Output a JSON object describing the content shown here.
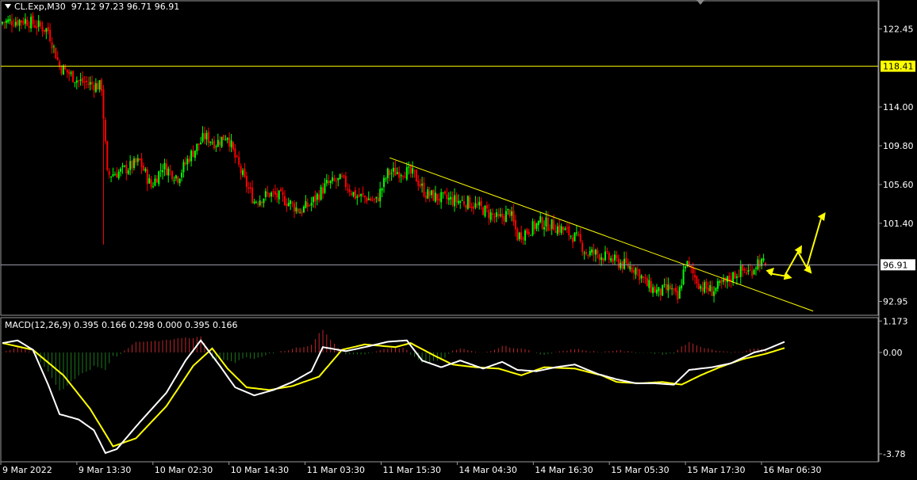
{
  "header": {
    "symbol": "CL.Exp,M30",
    "ohlc": "97.12 97.23 96.71 96.91"
  },
  "macd_header": {
    "label": "MACD(12,26,9)",
    "values": "0.395 0.166 0.298 0.000 0.395 0.166"
  },
  "colors": {
    "background": "#000000",
    "bull": "#00ff00",
    "bear": "#ff0000",
    "level_line": "#ffff00",
    "trendline": "#ffff00",
    "macd_main": "#ffffff",
    "macd_signal": "#ffff00",
    "price_line": "#a0a0b0",
    "arrows": "#ffff00"
  },
  "chart_data": [
    {
      "type": "candlestick",
      "title": "CL.Exp,M30",
      "price_axis_ticks": [
        "122.45",
        "118.41",
        "114.00",
        "109.80",
        "105.60",
        "101.40",
        "96.91",
        "92.95"
      ],
      "ylim": [
        91.4,
        125.5
      ],
      "time_axis_ticks": [
        "9 Mar 2022",
        "9 Mar 13:30",
        "10 Mar 02:30",
        "10 Mar 14:30",
        "11 Mar 03:30",
        "11 Mar 15:30",
        "14 Mar 04:30",
        "14 Mar 16:30",
        "15 Mar 05:30",
        "15 Mar 17:30",
        "16 Mar 06:30"
      ],
      "horizontal_level": "118.41",
      "current_price": "96.91",
      "last_bar": {
        "open": 97.12,
        "high": 97.23,
        "low": 96.71,
        "close": 96.91
      },
      "trendline": {
        "start": {
          "bar": 203,
          "price": 108.5
        },
        "end": {
          "bar": 425,
          "price": 91.9
        }
      },
      "close_path": [
        [
          0,
          123.2
        ],
        [
          12,
          123.4
        ],
        [
          24,
          122.3
        ],
        [
          30,
          118.4
        ],
        [
          40,
          116.8
        ],
        [
          52,
          116.2
        ],
        [
          55,
          106.6
        ],
        [
          62,
          107.0
        ],
        [
          72,
          108.1
        ],
        [
          78,
          105.4
        ],
        [
          84,
          107.6
        ],
        [
          92,
          106.4
        ],
        [
          98,
          108.6
        ],
        [
          106,
          110.8
        ],
        [
          112,
          110.1
        ],
        [
          118,
          111.0
        ],
        [
          122,
          108.5
        ],
        [
          127,
          106.0
        ],
        [
          132,
          103.8
        ],
        [
          140,
          104.6
        ],
        [
          146,
          104.2
        ],
        [
          152,
          103.4
        ],
        [
          156,
          102.7
        ],
        [
          162,
          103.6
        ],
        [
          170,
          105.6
        ],
        [
          178,
          106.1
        ],
        [
          185,
          104.4
        ],
        [
          190,
          104.2
        ],
        [
          196,
          103.8
        ],
        [
          202,
          106.8
        ],
        [
          210,
          107.1
        ],
        [
          216,
          106.6
        ],
        [
          222,
          104.6
        ],
        [
          228,
          104.2
        ],
        [
          236,
          103.9
        ],
        [
          244,
          103.7
        ],
        [
          252,
          102.9
        ],
        [
          260,
          101.8
        ],
        [
          266,
          102.7
        ],
        [
          270,
          100.0
        ],
        [
          276,
          100.7
        ],
        [
          282,
          101.5
        ],
        [
          288,
          101.2
        ],
        [
          294,
          100.7
        ],
        [
          302,
          99.6
        ],
        [
          306,
          98.2
        ],
        [
          312,
          98.1
        ],
        [
          318,
          97.6
        ],
        [
          326,
          96.9
        ],
        [
          332,
          96.5
        ],
        [
          338,
          94.7
        ],
        [
          344,
          93.9
        ],
        [
          350,
          94.4
        ],
        [
          354,
          93.1
        ],
        [
          358,
          97.2
        ],
        [
          362,
          95.9
        ],
        [
          366,
          94.6
        ],
        [
          372,
          94.1
        ],
        [
          378,
          94.8
        ],
        [
          384,
          95.9
        ],
        [
          388,
          96.3
        ],
        [
          392,
          96.1
        ],
        [
          396,
          97.3
        ],
        [
          400,
          96.91
        ]
      ],
      "forecast_arrows": "yellow projection arrows pointing up to the right of the last bar"
    },
    {
      "type": "macd",
      "title": "MACD(12,26,9)",
      "params": [
        12,
        26,
        9
      ],
      "values": {
        "main": 0.395,
        "signal": 0.166
      },
      "axis_ticks": [
        "1.173",
        "0.00",
        "-3.78"
      ],
      "ylim": [
        -3.78,
        1.173
      ],
      "main_path": [
        [
          0,
          0.35
        ],
        [
          8,
          0.45
        ],
        [
          16,
          0.1
        ],
        [
          24,
          -1.2
        ],
        [
          30,
          -2.3
        ],
        [
          40,
          -2.5
        ],
        [
          48,
          -2.9
        ],
        [
          54,
          -3.75
        ],
        [
          60,
          -3.6
        ],
        [
          72,
          -2.6
        ],
        [
          86,
          -1.5
        ],
        [
          96,
          -0.3
        ],
        [
          104,
          0.45
        ],
        [
          114,
          -0.5
        ],
        [
          122,
          -1.3
        ],
        [
          132,
          -1.6
        ],
        [
          142,
          -1.4
        ],
        [
          152,
          -1.1
        ],
        [
          162,
          -0.7
        ],
        [
          168,
          0.2
        ],
        [
          180,
          0.05
        ],
        [
          190,
          0.2
        ],
        [
          202,
          0.4
        ],
        [
          212,
          0.45
        ],
        [
          220,
          -0.3
        ],
        [
          230,
          -0.55
        ],
        [
          240,
          -0.3
        ],
        [
          252,
          -0.6
        ],
        [
          262,
          -0.35
        ],
        [
          270,
          -0.65
        ],
        [
          280,
          -0.7
        ],
        [
          290,
          -0.55
        ],
        [
          300,
          -0.45
        ],
        [
          312,
          -0.8
        ],
        [
          322,
          -1.0
        ],
        [
          332,
          -1.15
        ],
        [
          342,
          -1.15
        ],
        [
          352,
          -1.2
        ],
        [
          360,
          -0.65
        ],
        [
          372,
          -0.55
        ],
        [
          382,
          -0.4
        ],
        [
          394,
          0.0
        ],
        [
          400,
          0.1
        ],
        [
          410,
          0.395
        ]
      ],
      "signal_path": [
        [
          0,
          0.35
        ],
        [
          16,
          0.1
        ],
        [
          32,
          -0.85
        ],
        [
          46,
          -2.1
        ],
        [
          58,
          -3.5
        ],
        [
          70,
          -3.2
        ],
        [
          86,
          -2.0
        ],
        [
          100,
          -0.5
        ],
        [
          110,
          0.15
        ],
        [
          118,
          -0.6
        ],
        [
          128,
          -1.3
        ],
        [
          140,
          -1.4
        ],
        [
          152,
          -1.25
        ],
        [
          166,
          -0.9
        ],
        [
          178,
          0.1
        ],
        [
          190,
          0.3
        ],
        [
          206,
          0.2
        ],
        [
          214,
          0.35
        ],
        [
          226,
          -0.1
        ],
        [
          236,
          -0.45
        ],
        [
          248,
          -0.55
        ],
        [
          260,
          -0.6
        ],
        [
          272,
          -0.85
        ],
        [
          284,
          -0.55
        ],
        [
          300,
          -0.6
        ],
        [
          314,
          -0.85
        ],
        [
          322,
          -1.1
        ],
        [
          334,
          -1.15
        ],
        [
          346,
          -1.1
        ],
        [
          356,
          -1.2
        ],
        [
          366,
          -0.85
        ],
        [
          376,
          -0.55
        ],
        [
          388,
          -0.25
        ],
        [
          400,
          -0.05
        ],
        [
          410,
          0.166
        ]
      ]
    }
  ]
}
